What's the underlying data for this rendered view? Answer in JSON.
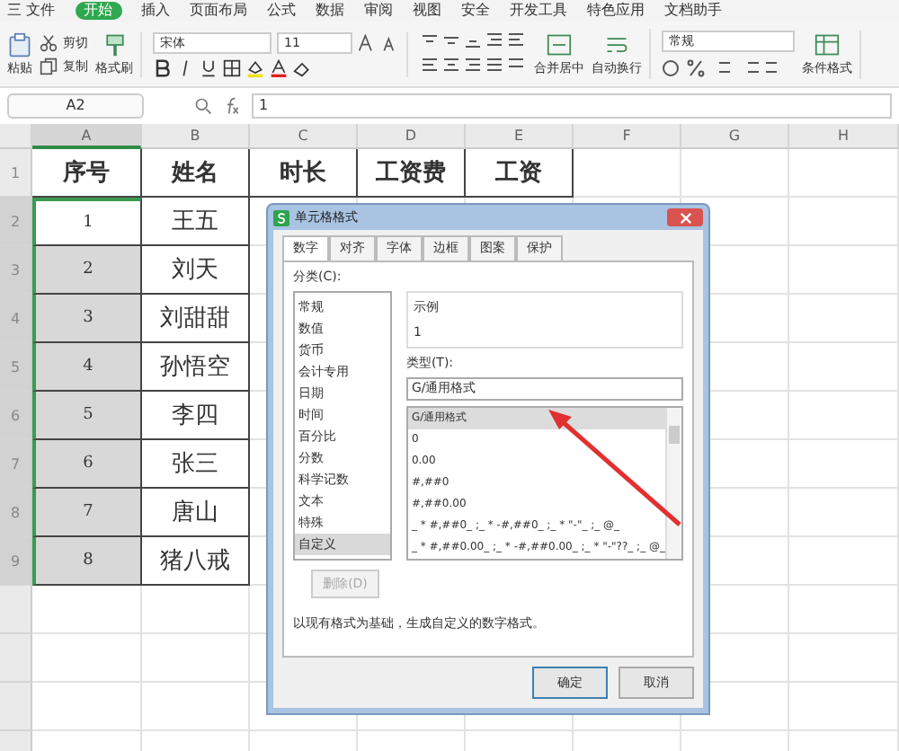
{
  "menu": [
    {
      "label": "三 文件",
      "selected": false
    },
    {
      "label": "开始",
      "selected": true
    },
    {
      "label": "插入",
      "selected": false
    },
    {
      "label": "页面布局",
      "selected": false
    },
    {
      "label": "公式",
      "selected": false
    },
    {
      "label": "数据",
      "selected": false
    },
    {
      "label": "审阅",
      "selected": false
    },
    {
      "label": "视图",
      "selected": false
    },
    {
      "label": "安全",
      "selected": false
    },
    {
      "label": "开发工具",
      "selected": false
    },
    {
      "label": "特色应用",
      "selected": false
    },
    {
      "label": "文档助手",
      "selected": false
    }
  ],
  "toolbar": {
    "paste": "粘贴",
    "cut": "剪切",
    "copy": "复制",
    "format_painter": "格式刷",
    "font": "宋体",
    "size": "11",
    "merge": "合并居中",
    "wrap": "自动换行",
    "number_format": "常规",
    "conditional": "条件格式"
  },
  "formula_bar": {
    "cell": "A2",
    "value": "1"
  },
  "columns": [
    {
      "label": "A",
      "selected": true
    },
    {
      "label": "B",
      "selected": false
    },
    {
      "label": "C",
      "selected": false
    },
    {
      "label": "D",
      "selected": false
    },
    {
      "label": "E",
      "selected": false
    },
    {
      "label": "F",
      "selected": false
    },
    {
      "label": "G",
      "selected": false
    },
    {
      "label": "H",
      "selected": false
    }
  ],
  "rows": [
    {
      "number": "1",
      "selected": false,
      "cells": [
        "序号",
        "姓名",
        "时长",
        "工资费",
        "工资"
      ]
    },
    {
      "number": "2",
      "selected": true,
      "cells": [
        "1",
        "王五"
      ]
    },
    {
      "number": "3",
      "selected": true,
      "cells": [
        "2",
        "刘天"
      ]
    },
    {
      "number": "4",
      "selected": true,
      "cells": [
        "3",
        "刘甜甜"
      ]
    },
    {
      "number": "5",
      "selected": true,
      "cells": [
        "4",
        "孙悟空"
      ]
    },
    {
      "number": "6",
      "selected": true,
      "cells": [
        "5",
        "李四"
      ]
    },
    {
      "number": "7",
      "selected": true,
      "cells": [
        "6",
        "张三"
      ]
    },
    {
      "number": "8",
      "selected": true,
      "cells": [
        "7",
        "唐山"
      ]
    },
    {
      "number": "9",
      "selected": true,
      "cells": [
        "8",
        "猪八戒"
      ]
    }
  ],
  "dialog": {
    "title": "单元格格式",
    "tabs": [
      {
        "label": "数字",
        "selected": true
      },
      {
        "label": "对齐",
        "selected": false
      },
      {
        "label": "字体",
        "selected": false
      },
      {
        "label": "边框",
        "selected": false
      },
      {
        "label": "图案",
        "selected": false
      },
      {
        "label": "保护",
        "selected": false
      }
    ],
    "category_label": "分类(C):",
    "categories": [
      {
        "label": "常规",
        "selected": false
      },
      {
        "label": "数值",
        "selected": false
      },
      {
        "label": "货币",
        "selected": false
      },
      {
        "label": "会计专用",
        "selected": false
      },
      {
        "label": "日期",
        "selected": false
      },
      {
        "label": "时间",
        "selected": false
      },
      {
        "label": "百分比",
        "selected": false
      },
      {
        "label": "分数",
        "selected": false
      },
      {
        "label": "科学记数",
        "selected": false
      },
      {
        "label": "文本",
        "selected": false
      },
      {
        "label": "特殊",
        "selected": false
      },
      {
        "label": "自定义",
        "selected": true
      }
    ],
    "sample_label": "示例",
    "sample_value": "1",
    "type_label": "类型(T):",
    "type_value": "G/通用格式",
    "types": [
      {
        "label": "G/通用格式",
        "selected": true
      },
      {
        "label": "0",
        "selected": false
      },
      {
        "label": "0.00",
        "selected": false
      },
      {
        "label": "#,##0",
        "selected": false
      },
      {
        "label": "#,##0.00",
        "selected": false
      },
      {
        "label": "_ * #,##0_ ;_ * -#,##0_ ;_ * \"-\"_ ;_ @_",
        "selected": false
      },
      {
        "label": "_ * #,##0.00_ ;_ * -#,##0.00_ ;_ * \"-\"??_ ;_ @_",
        "selected": false
      }
    ],
    "delete_button": {
      "label": "删除(D)",
      "disabled": true
    },
    "description": "以现有格式为基础，生成自定义的数字格式。",
    "buttons": [
      "确定",
      "取消"
    ]
  }
}
